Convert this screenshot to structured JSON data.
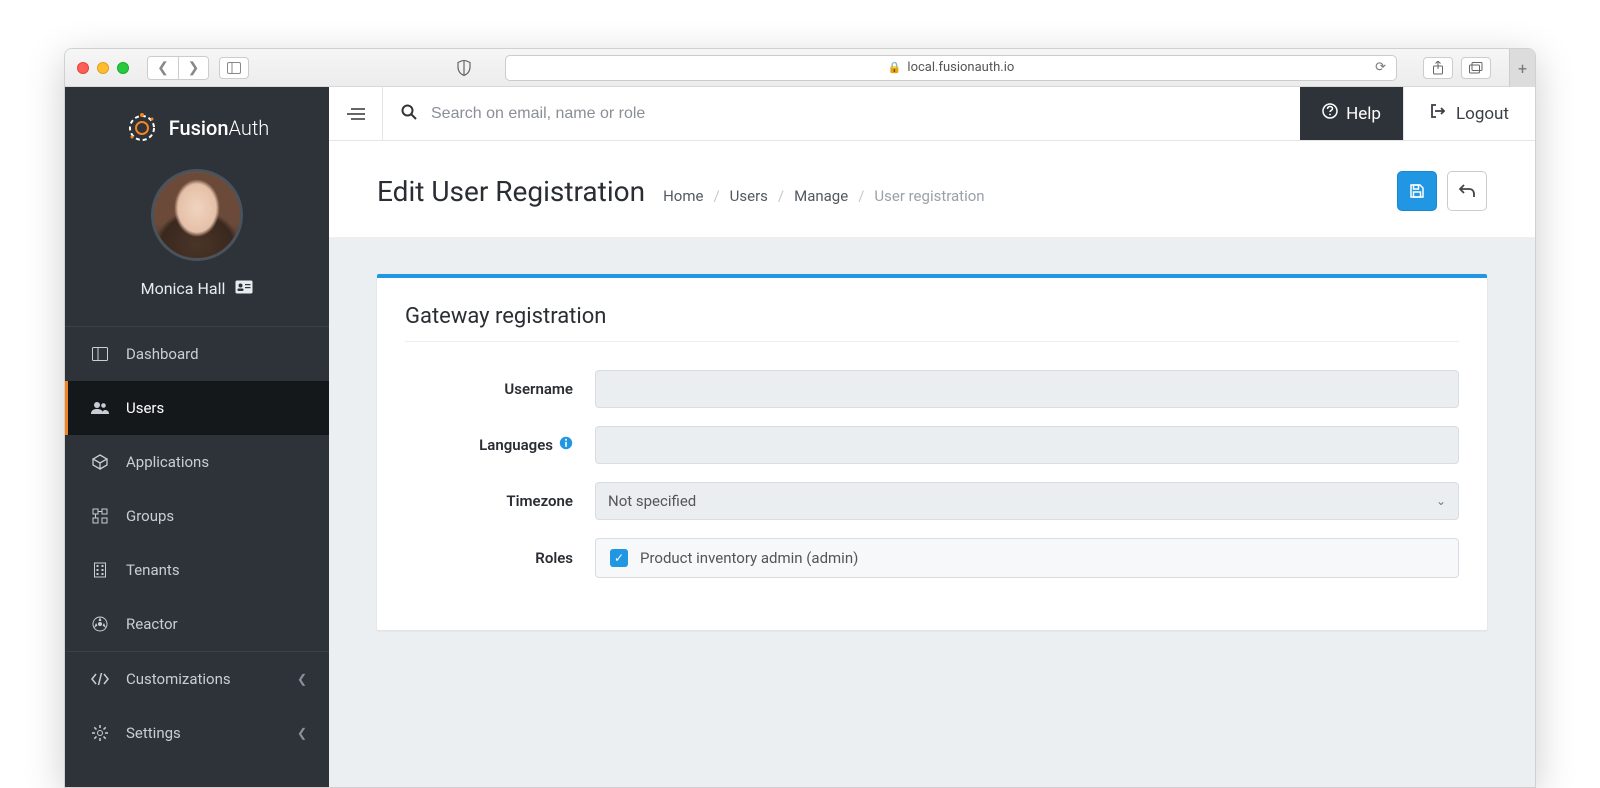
{
  "browser": {
    "url": "local.fusionauth.io"
  },
  "brand": {
    "name_part1": "Fusion",
    "name_part2": "Auth"
  },
  "user": {
    "display_name": "Monica Hall"
  },
  "sidebar": {
    "items": [
      {
        "label": "Dashboard"
      },
      {
        "label": "Users"
      },
      {
        "label": "Applications"
      },
      {
        "label": "Groups"
      },
      {
        "label": "Tenants"
      },
      {
        "label": "Reactor"
      },
      {
        "label": "Customizations"
      },
      {
        "label": "Settings"
      }
    ]
  },
  "topbar": {
    "search_placeholder": "Search on email, name or role",
    "help_label": "Help",
    "logout_label": "Logout"
  },
  "page": {
    "title": "Edit User Registration",
    "breadcrumb": {
      "home": "Home",
      "users": "Users",
      "manage": "Manage",
      "current": "User registration"
    }
  },
  "panel": {
    "title": "Gateway registration",
    "labels": {
      "username": "Username",
      "languages": "Languages",
      "timezone": "Timezone",
      "roles": "Roles"
    },
    "values": {
      "username": "",
      "languages": "",
      "timezone": "Not specified"
    },
    "roles": [
      {
        "label": "Product inventory admin (admin)",
        "checked": true
      }
    ]
  },
  "colors": {
    "accent": "#f58320",
    "primary": "#2196e3",
    "sidebar_bg": "#2d3339"
  }
}
